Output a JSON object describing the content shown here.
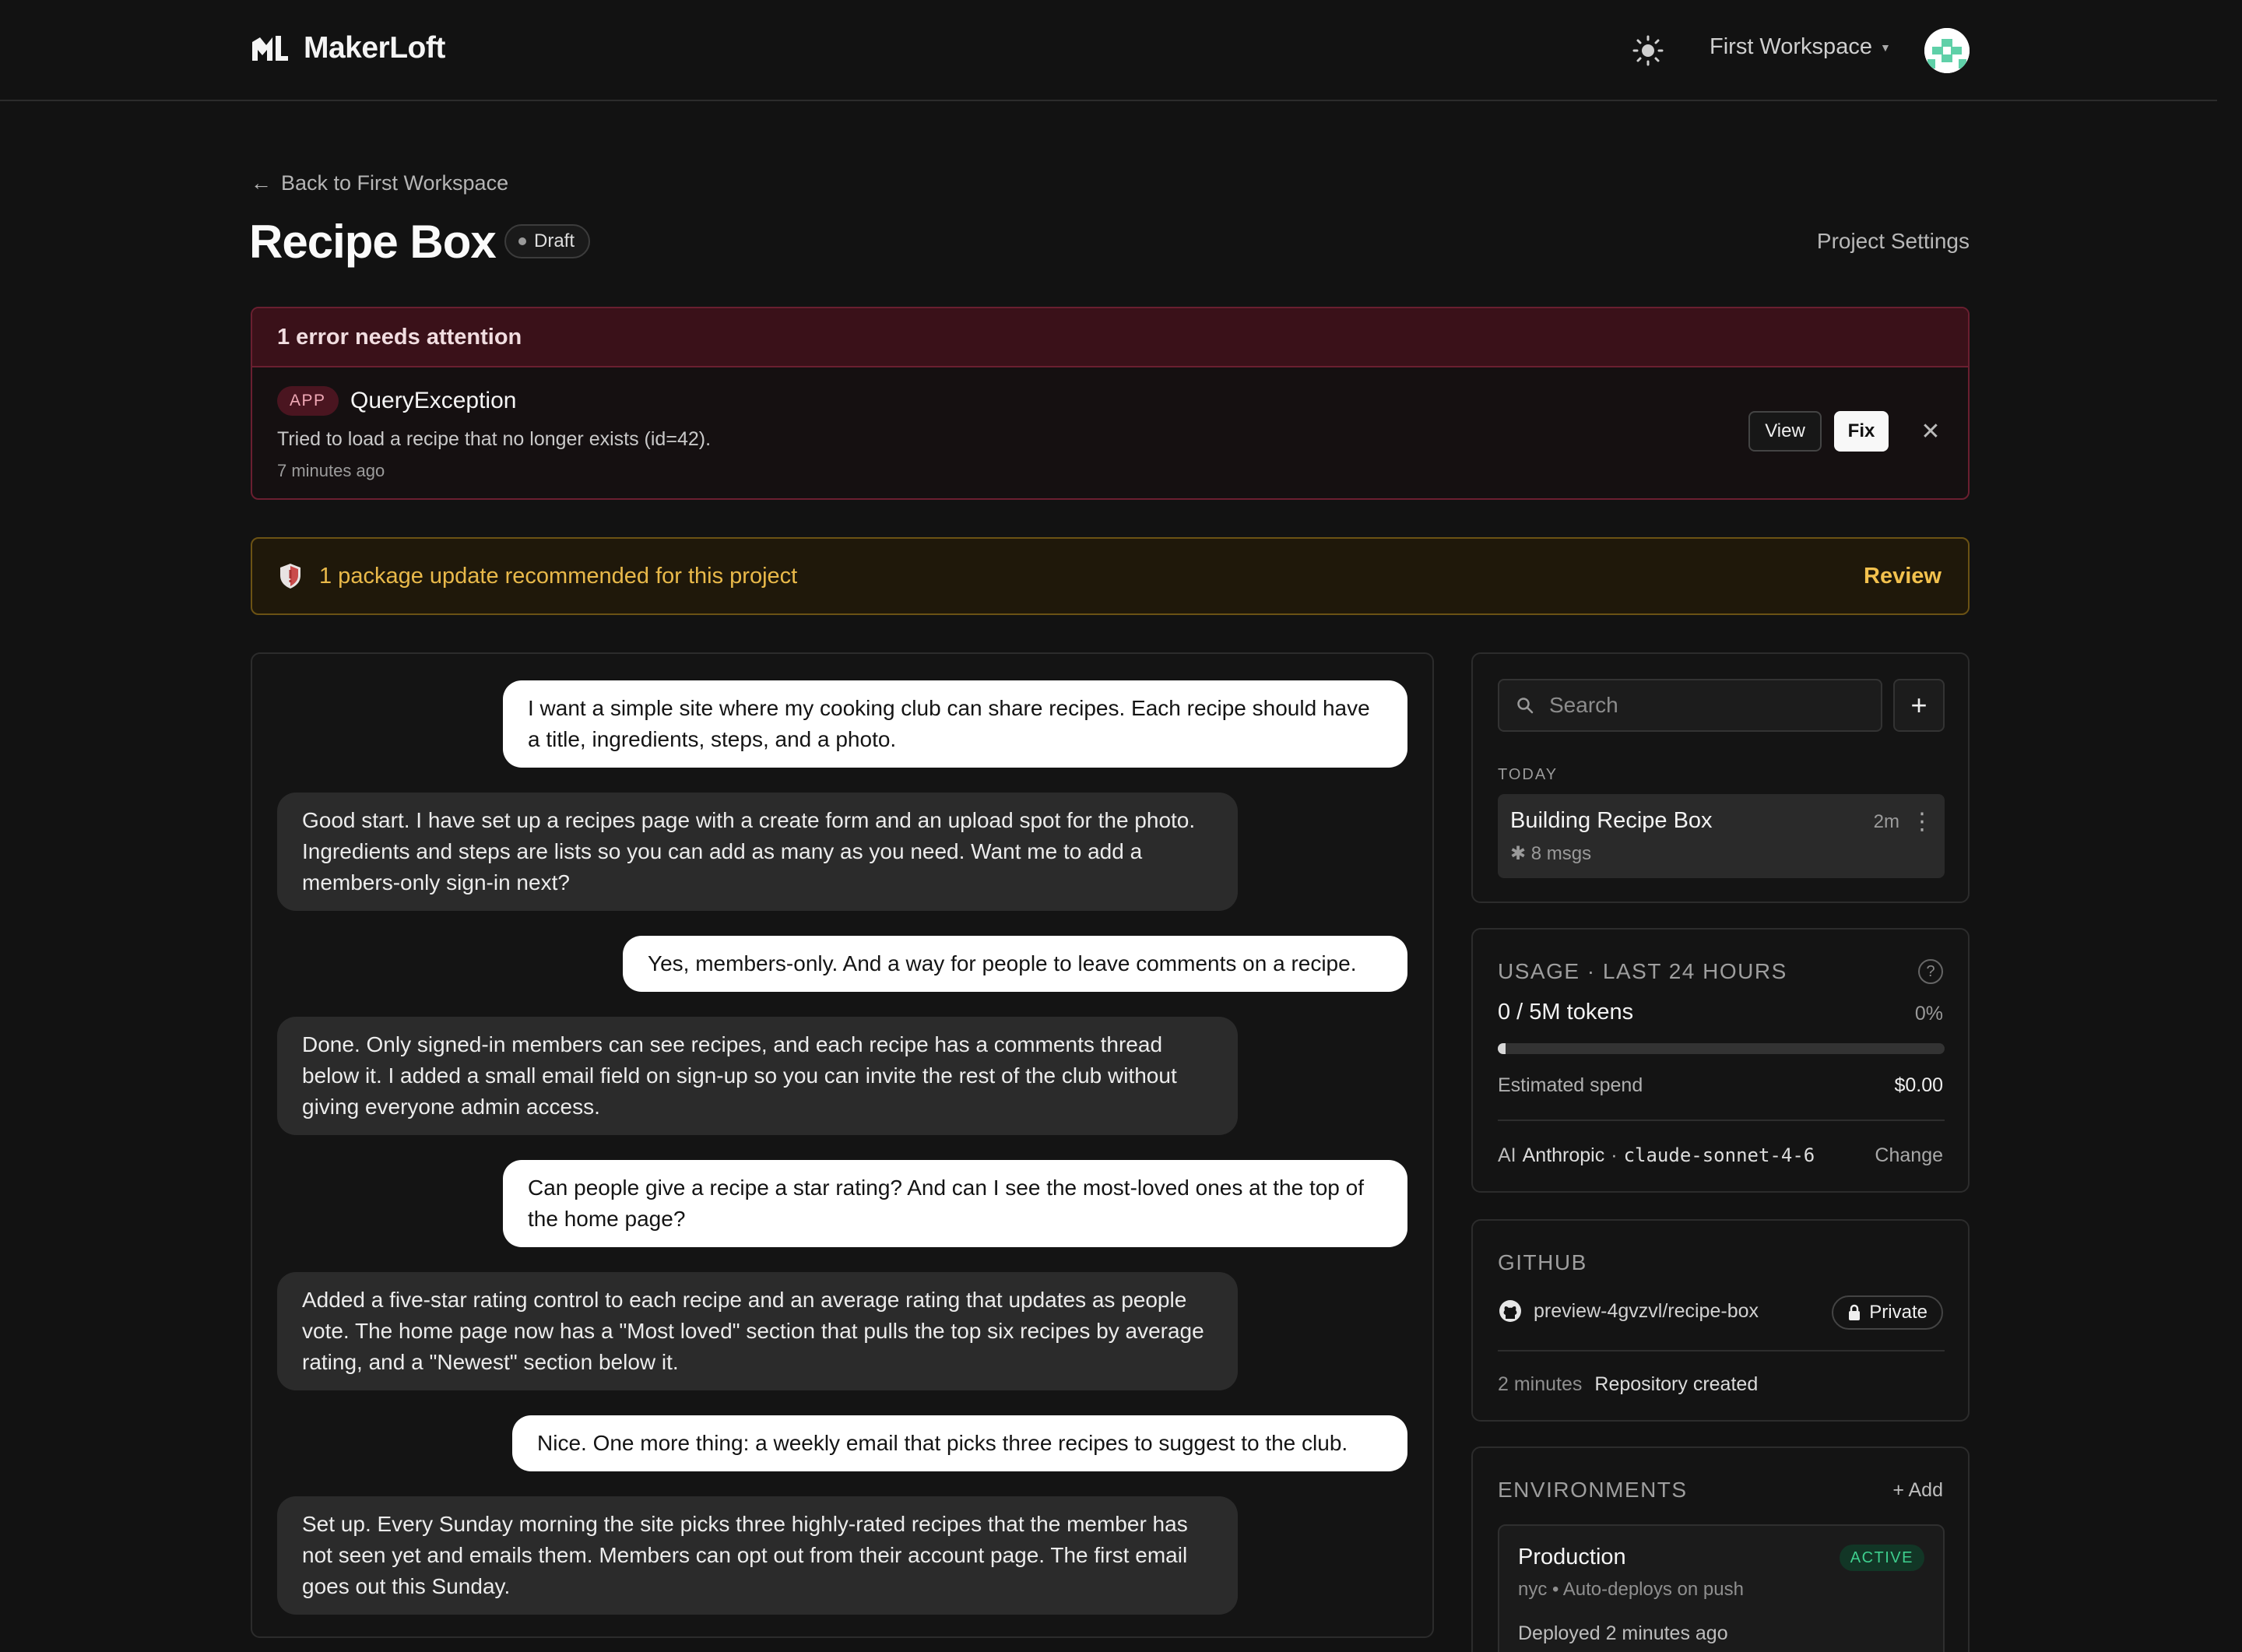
{
  "header": {
    "brand": "MakerLoft",
    "workspace": "First Workspace"
  },
  "page": {
    "back_label": "Back to First Workspace",
    "title": "Recipe Box",
    "status_badge": "Draft",
    "settings_link": "Project Settings"
  },
  "error_banner": {
    "heading": "1 error needs attention",
    "tag": "APP",
    "type": "QueryException",
    "message": "Tried to load a recipe that no longer exists (id=42).",
    "time": "7 minutes ago",
    "view_label": "View",
    "fix_label": "Fix",
    "close_glyph": "✕"
  },
  "update_banner": {
    "text": "1 package update recommended for this project",
    "action": "Review"
  },
  "chat": {
    "messages": [
      {
        "role": "user",
        "text": "I want a simple site where my cooking club can share recipes. Each recipe should have a title, ingredients, steps, and a photo."
      },
      {
        "role": "assistant",
        "text": "Good start. I have set up a recipes page with a create form and an upload spot for the photo. Ingredients and steps are lists so you can add as many as you need. Want me to add a members-only sign-in next?"
      },
      {
        "role": "user",
        "text": "Yes, members-only. And a way for people to leave comments on a recipe."
      },
      {
        "role": "assistant",
        "text": "Done. Only signed-in members can see recipes, and each recipe has a comments thread below it. I added a small email field on sign-up so you can invite the rest of the club without giving everyone admin access."
      },
      {
        "role": "user",
        "text": "Can people give a recipe a star rating? And can I see the most-loved ones at the top of the home page?"
      },
      {
        "role": "assistant",
        "text": "Added a five-star rating control to each recipe and an average rating that updates as people vote. The home page now has a \"Most loved\" section that pulls the top six recipes by average rating, and a \"Newest\" section below it."
      },
      {
        "role": "user",
        "text": "Nice. One more thing: a weekly email that picks three recipes to suggest to the club."
      },
      {
        "role": "assistant",
        "text": "Set up. Every Sunday morning the site picks three highly-rated recipes that the member has not seen yet and emails them. Members can opt out from their account page. The first email goes out this Sunday."
      }
    ]
  },
  "conversations": {
    "search_placeholder": "Search",
    "new_label": "+",
    "group_label": "TODAY",
    "items": [
      {
        "title": "Building Recipe Box",
        "time": "2m",
        "meta": "✱ 8 msgs",
        "more": "⋮"
      }
    ]
  },
  "usage": {
    "title": "USAGE · LAST 24 HOURS",
    "help": "?",
    "tokens": "0 / 5M tokens",
    "percent": "0%",
    "progress": 0,
    "spend_label": "Estimated spend",
    "spend_value": "$0.00",
    "ai_prefix": "AI",
    "provider": "Anthropic",
    "separator": "·",
    "model": "claude-sonnet-4-6",
    "change_label": "Change"
  },
  "github": {
    "title": "GITHUB",
    "repo": "preview-4gvzvl/recipe-box",
    "visibility": "Private",
    "event_time": "2 minutes",
    "event_text": "Repository created"
  },
  "environments": {
    "title": "ENVIRONMENTS",
    "add_label": "+ Add",
    "items": [
      {
        "name": "Production",
        "status": "ACTIVE",
        "meta": "nyc • Auto-deploys on push",
        "deployed": "Deployed 2 minutes ago"
      }
    ]
  },
  "colors": {
    "background": "#121212",
    "error_accent": "#6a1f30",
    "warning_accent": "#f2c14e",
    "active_green": "#3ecf8e"
  },
  "icons": [
    "logo-icon",
    "sun-icon",
    "avatar",
    "arrow-left-icon",
    "shield-icon",
    "search-icon",
    "plus-icon",
    "more-icon",
    "help-icon",
    "github-icon",
    "lock-icon",
    "close-icon"
  ]
}
